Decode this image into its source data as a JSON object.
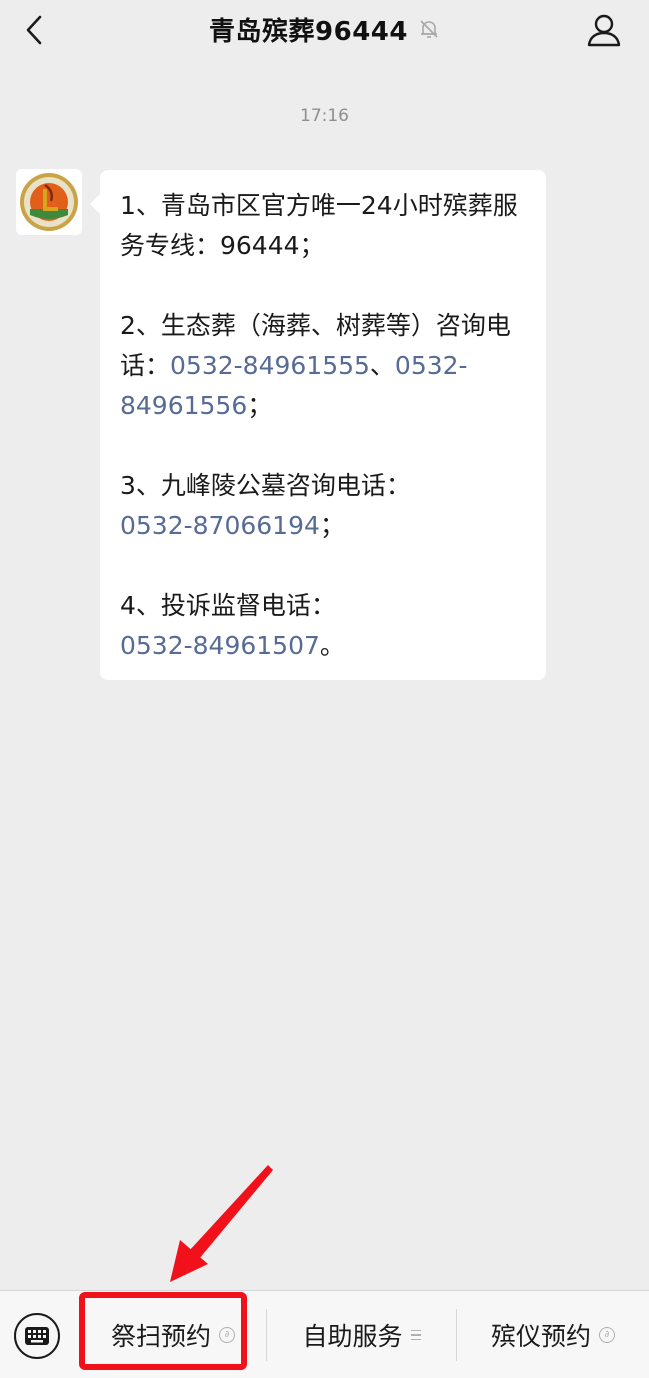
{
  "header": {
    "title": "青岛殡葬96444",
    "back_icon": "chevron-left-icon",
    "mute_icon": "bell-off-icon",
    "profile_icon": "person-icon"
  },
  "chat": {
    "timestamp": "17:16",
    "message": {
      "p1": "1、青岛市区官方唯一24小时殡葬服务专线：96444；",
      "p2_text": "2、生态葬（海葬、树葬等）咨询电话：",
      "p2_phone1": "0532-84961555",
      "p2_sep": "、",
      "p2_phone2": "0532-84961556",
      "p2_end": "；",
      "p3_text": "3、九峰陵公墓咨询电话：",
      "p3_phone": "0532-87066194",
      "p3_end": "；",
      "p4_text": "4、投诉监督电话：",
      "p4_phone": "0532-84961507",
      "p4_end": "。"
    }
  },
  "menu": {
    "keyboard_icon": "keyboard-icon",
    "items": [
      {
        "label": "祭扫预约",
        "icon": "mini-program-icon"
      },
      {
        "label": "自助服务",
        "icon": "submenu-list-icon"
      },
      {
        "label": "殡仪预约",
        "icon": "mini-program-icon"
      }
    ]
  },
  "colors": {
    "background": "#ededed",
    "link": "#576b95",
    "annotation": "#f1111b"
  }
}
